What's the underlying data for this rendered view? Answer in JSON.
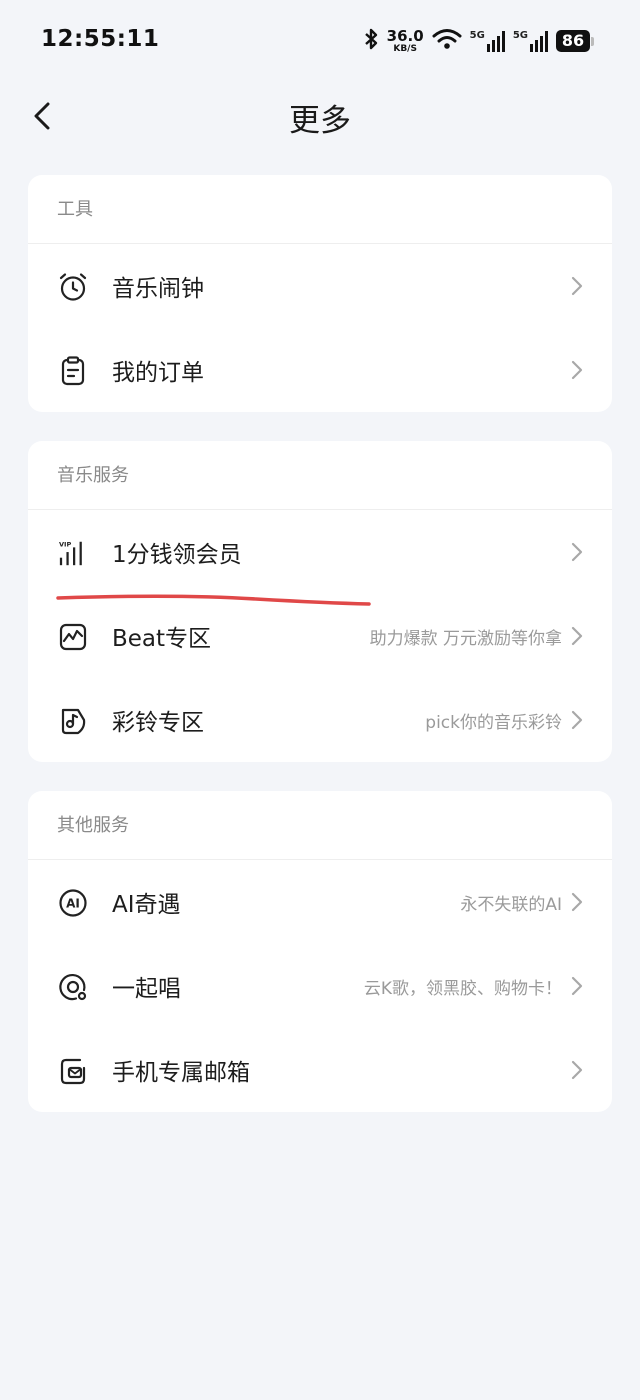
{
  "status_bar": {
    "time": "12:55:11",
    "net_speed_value": "36.0",
    "net_speed_unit": "KB/S",
    "signal_1_label": "5G",
    "signal_2_label": "5G",
    "battery": "86"
  },
  "nav": {
    "title": "更多",
    "back_icon": "chevron-left-icon"
  },
  "sections": [
    {
      "header": "工具",
      "items": [
        {
          "label": "音乐闹钟",
          "sub": "",
          "icon": "alarm-clock-icon"
        },
        {
          "label": "我的订单",
          "sub": "",
          "icon": "clipboard-icon"
        }
      ]
    },
    {
      "header": "音乐服务",
      "items": [
        {
          "label": "1分钱领会员",
          "sub": "",
          "icon": "vip-bars-icon",
          "icon_text": "VIP"
        },
        {
          "label": "Beat专区",
          "sub": "助力爆款 万元激励等你拿",
          "icon": "wave-chart-icon"
        },
        {
          "label": "彩铃专区",
          "sub": "pick你的音乐彩铃",
          "icon": "ringtone-note-icon"
        }
      ]
    },
    {
      "header": "其他服务",
      "items": [
        {
          "label": "AI奇遇",
          "sub": "永不失联的AI",
          "icon": "ai-circle-icon",
          "icon_text": "AI"
        },
        {
          "label": "一起唱",
          "sub": "云K歌，领黑胶、购物卡！",
          "icon": "sing-together-icon"
        },
        {
          "label": "手机专属邮箱",
          "sub": "",
          "icon": "mailbox-icon"
        }
      ]
    }
  ],
  "colors": {
    "background": "#f3f5f9",
    "card": "#ffffff",
    "annotation": "#e04848",
    "muted_text": "#9a9a9a"
  }
}
